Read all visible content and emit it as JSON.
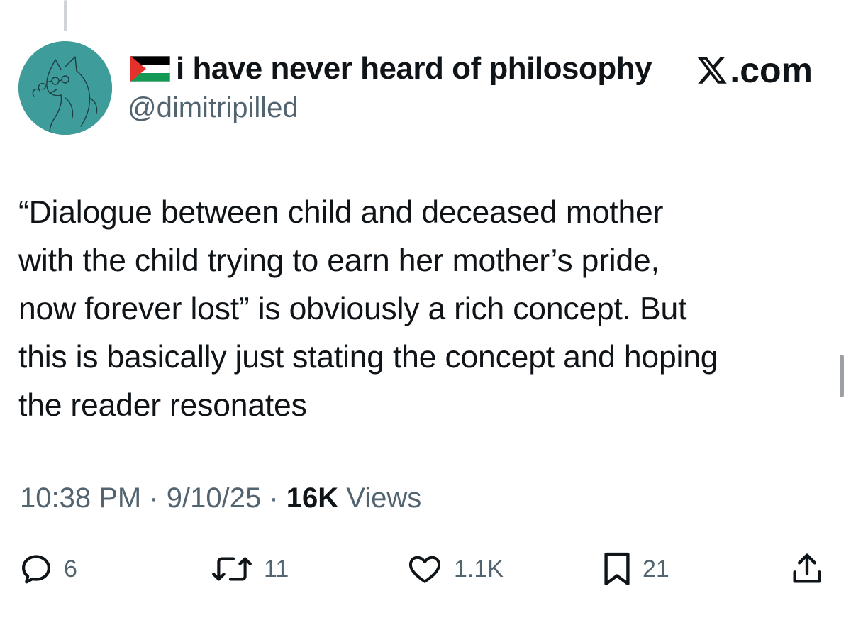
{
  "author": {
    "display_name": "i have never heard of philosophy",
    "handle": "@dimitripilled",
    "flag_icon": "palestine-flag-icon",
    "avatar_icon": "cat-sketch-avatar",
    "avatar_color": "#3e9d9a"
  },
  "brand": {
    "label": ".com",
    "icon": "x-logo-icon"
  },
  "tweet": {
    "text": "“Dialogue between child and deceased mother\nwith the child trying to earn her mother’s pride,\nnow forever lost” is obviously a rich concept. But\nthis is basically just stating the concept and hoping\nthe reader resonates"
  },
  "meta": {
    "time": "10:38 PM",
    "separator": " · ",
    "date": "9/10/25",
    "views_count": "16K",
    "views_label": " Views"
  },
  "actions": {
    "reply": {
      "icon": "reply-icon",
      "count": "6"
    },
    "repost": {
      "icon": "repost-icon",
      "count": "11"
    },
    "like": {
      "icon": "heart-icon",
      "count": "1.1K"
    },
    "bookmark": {
      "icon": "bookmark-icon",
      "count": "21"
    },
    "share": {
      "icon": "share-icon"
    }
  },
  "colors": {
    "text": "#0f1419",
    "secondary": "#536471",
    "flag_red": "#e4312b",
    "flag_green": "#149954"
  }
}
